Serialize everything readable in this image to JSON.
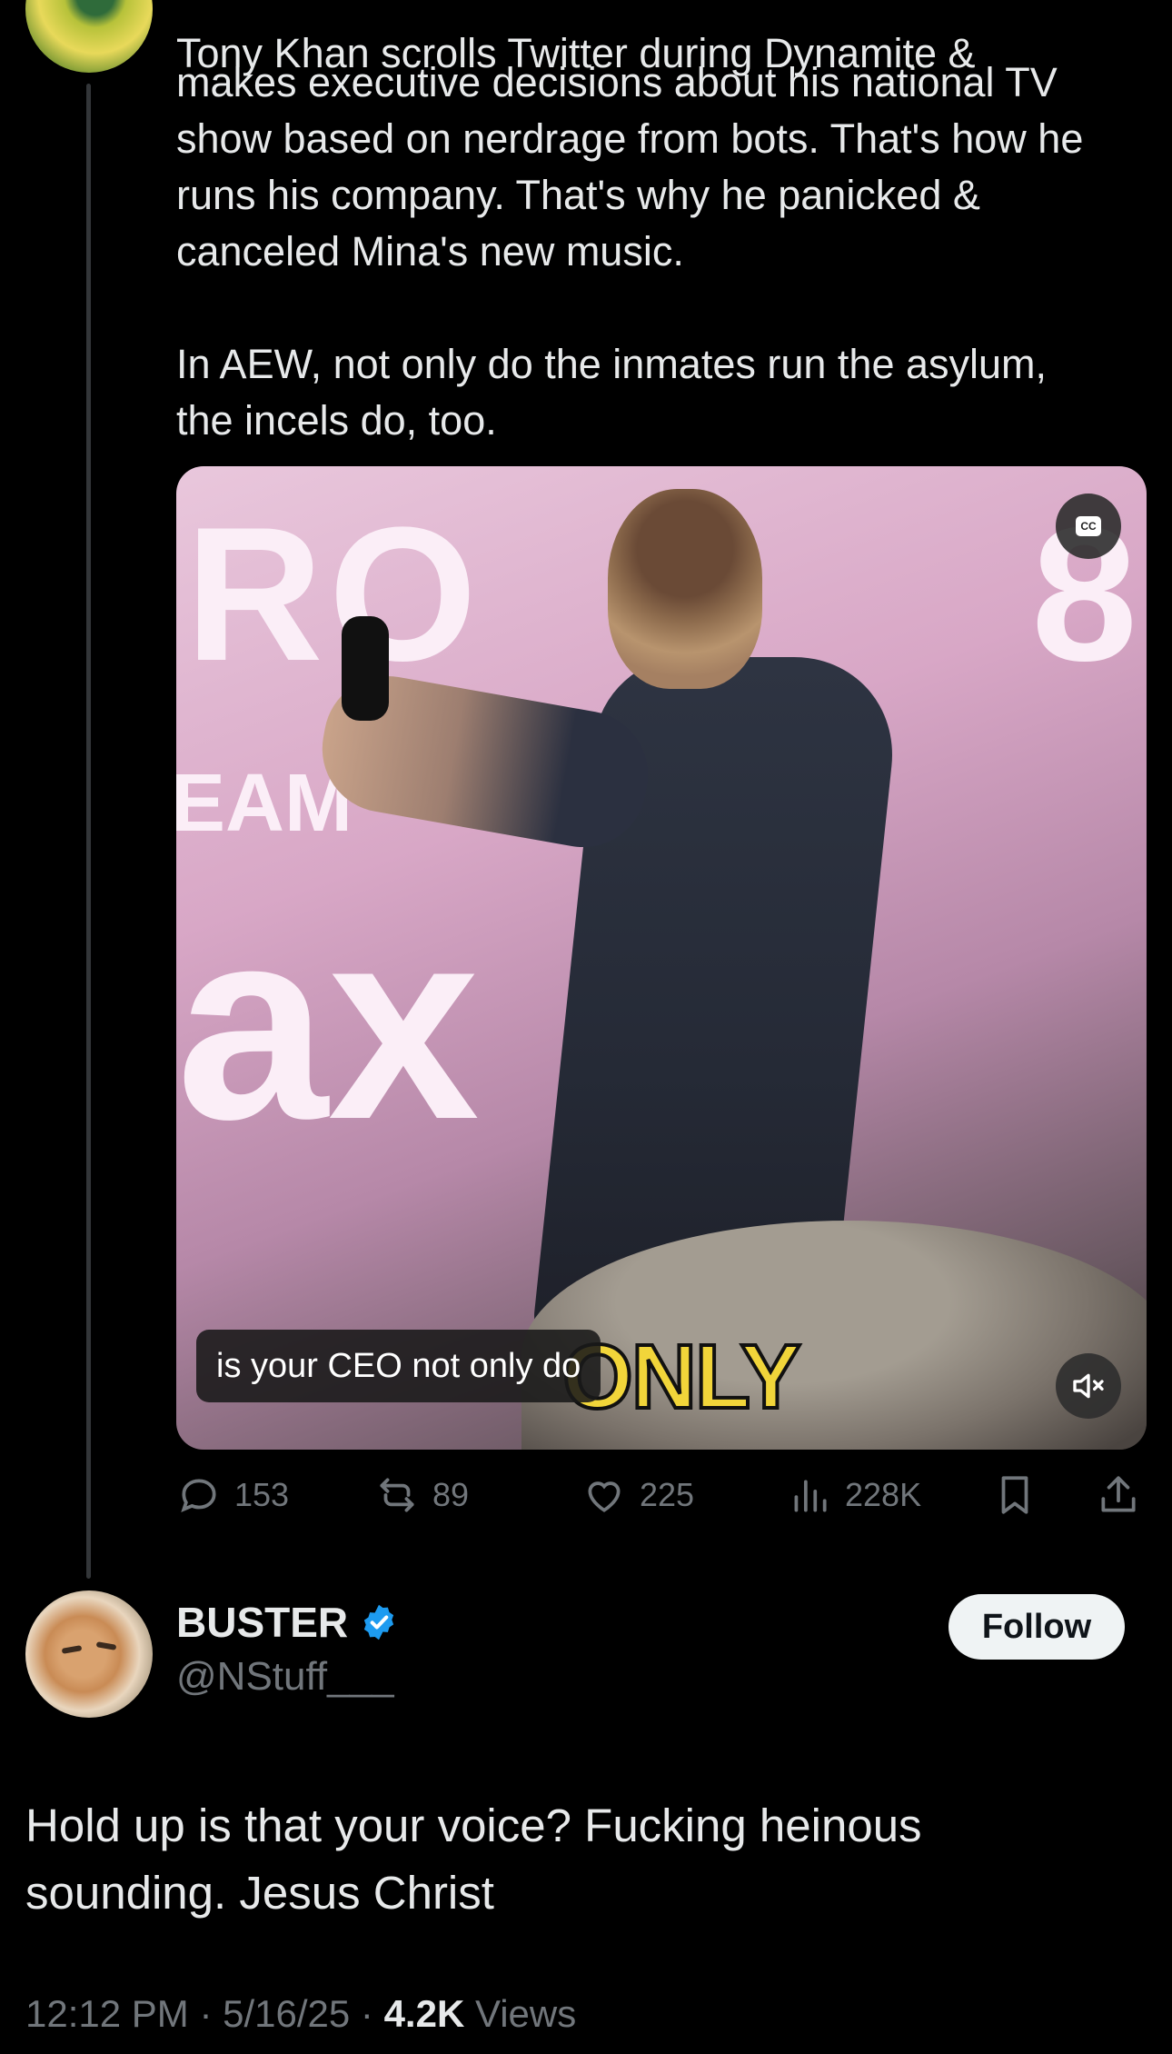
{
  "parent_tweet": {
    "first_line": "Tony Khan scrolls Twitter during Dynamite &",
    "body": "makes executive decisions about his national TV\nshow based on nerdrage from bots. That's how he\nruns his company. That's why he panicked &\ncanceled Mina's new music.\n\nIn AEW, not only do the inmates run the asylum,\nthe incels do, too.",
    "video": {
      "caption": "is your CEO not only do",
      "burned_text": "ONLY",
      "cc_label": "CC",
      "background_text_1": "RO",
      "background_text_2": "8",
      "background_text_3": "EAM",
      "background_text_4": "ax"
    },
    "actions": {
      "replies": "153",
      "reposts": "89",
      "likes": "225",
      "views": "228K"
    }
  },
  "reply_tweet": {
    "display_name": "BUSTER",
    "handle": "@NStuff___",
    "follow_label": "Follow",
    "text": "Hold up is that your voice? Fucking heinous sounding. Jesus Christ",
    "time": "12:12 PM",
    "date": "5/16/25",
    "views_count": "4.2K",
    "views_label": "Views"
  },
  "colors": {
    "background": "#000000",
    "text_primary": "#e7e9ea",
    "text_secondary": "#71767b",
    "verified_blue": "#1d9bf0",
    "follow_bg": "#eff3f4"
  }
}
